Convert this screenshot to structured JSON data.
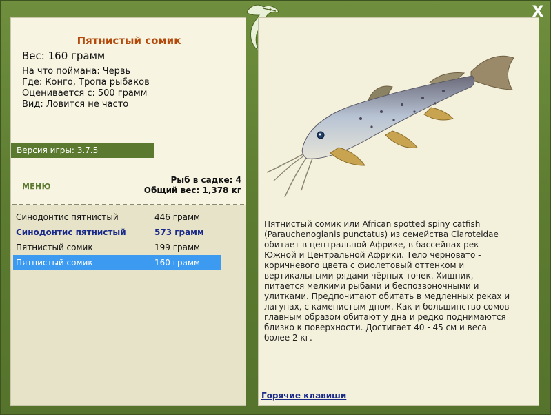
{
  "window": {
    "close_label": "X"
  },
  "fish": {
    "title": "Пятнистый сомик",
    "weight_label": "Вес:",
    "weight_value": "160 грамм",
    "details": [
      {
        "label": "На что поймана:",
        "value": "Червь"
      },
      {
        "label": "Где:",
        "value": "Конго, Тропа рыбаков"
      },
      {
        "label": "Оценивается с:",
        "value": "500 грамм"
      },
      {
        "label": "Вид:",
        "value": "Ловится не часто"
      }
    ]
  },
  "version": {
    "text": "Версия игры: 3.7.5"
  },
  "menu": {
    "label": "МЕНЮ"
  },
  "stats": {
    "cage_label": "Рыб в садке:",
    "cage_count": "4",
    "total_label": "Общий вес:",
    "total_value": "1,378 кг"
  },
  "catch_list": [
    {
      "name": "Синодонтис пятнистый",
      "weight": "446 грамм",
      "style": "normal"
    },
    {
      "name": "Синодонтис пятнистый",
      "weight": "573 грамм",
      "style": "bold"
    },
    {
      "name": "Пятнистый сомик",
      "weight": "199 грамм",
      "style": "normal"
    },
    {
      "name": "Пятнистый сомик",
      "weight": "160 грамм",
      "style": "selected"
    }
  ],
  "description": "Пятнистый сомик или African spotted spiny catfish (Parauchenoglanis punctatus) из семейства Claroteidae обитает в центральной Африке, в бассейнах рек Южной и Центральной Африки. Тело черновато - коричневого цвета с фиолетовый оттенком и вертикальными рядами чёрных точек. Хищник, питается мелкими рыбами и беспозвоночными и улитками. Предпочитают обитать в медленных реках и лагунах, с каменистым дном. Как и большинство сомов главным образом обитают у дна и редко поднимаются близко к поверхности. Достигает 40 - 45 см и веса более 2 кг.",
  "hotkeys": {
    "label": "Горячие клавиши"
  },
  "colors": {
    "frame": "#5d7c31",
    "panel": "#f3f0dc",
    "title": "#b34a0a",
    "selected_row": "#3c9bf0",
    "link": "#1a2a8a"
  },
  "icons": {
    "close": "close-icon",
    "logo": "leaf-fish-logo-icon"
  }
}
